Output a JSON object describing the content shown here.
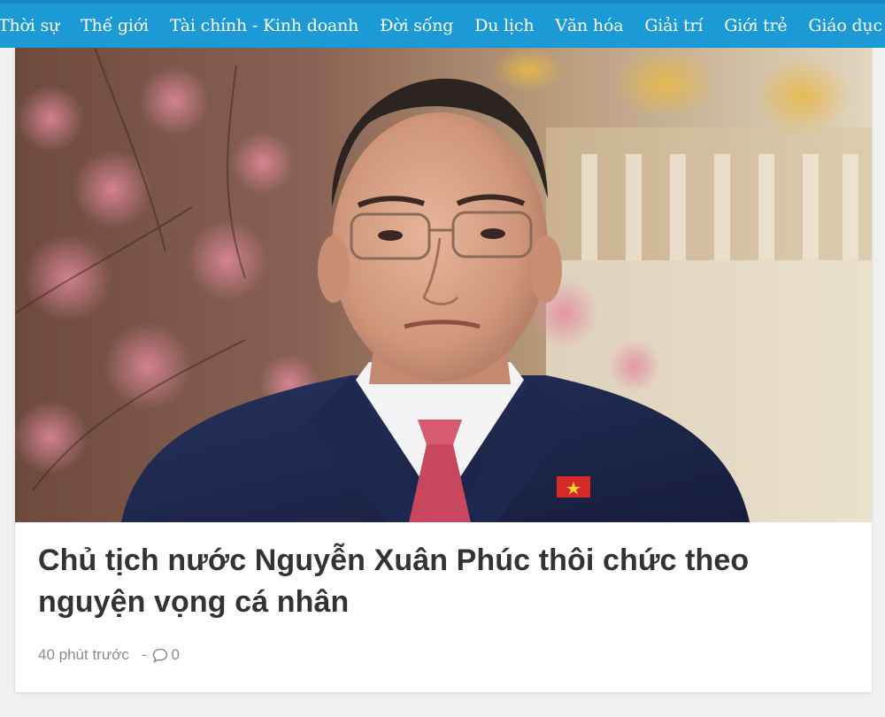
{
  "nav": {
    "items": [
      {
        "label": "Thời sự",
        "key": "thoi-su"
      },
      {
        "label": "Thế giới",
        "key": "the-gioi"
      },
      {
        "label": "Tài chính - Kinh doanh",
        "key": "tai-chinh"
      },
      {
        "label": "Đời sống",
        "key": "doi-song"
      },
      {
        "label": "Du lịch",
        "key": "du-lich"
      },
      {
        "label": "Văn hóa",
        "key": "van-hoa"
      },
      {
        "label": "Giải trí",
        "key": "giai-tri"
      },
      {
        "label": "Giới trẻ",
        "key": "gioi-tre"
      },
      {
        "label": "Giáo dục",
        "key": "giao-duc"
      }
    ]
  },
  "article": {
    "title": "Chủ tịch nước Nguyễn Xuân Phúc thôi chức theo nguyện vọng cá nhân",
    "time": "40 phút trước",
    "separator": "-",
    "comment_count": "0",
    "comment_icon": "comment-bubble-icon"
  },
  "colors": {
    "nav_bg": "#1c9ad6",
    "nav_text": "#ffffff",
    "headline": "#333333",
    "meta": "#8a8a8a",
    "page_bg": "#f0f0f0"
  }
}
